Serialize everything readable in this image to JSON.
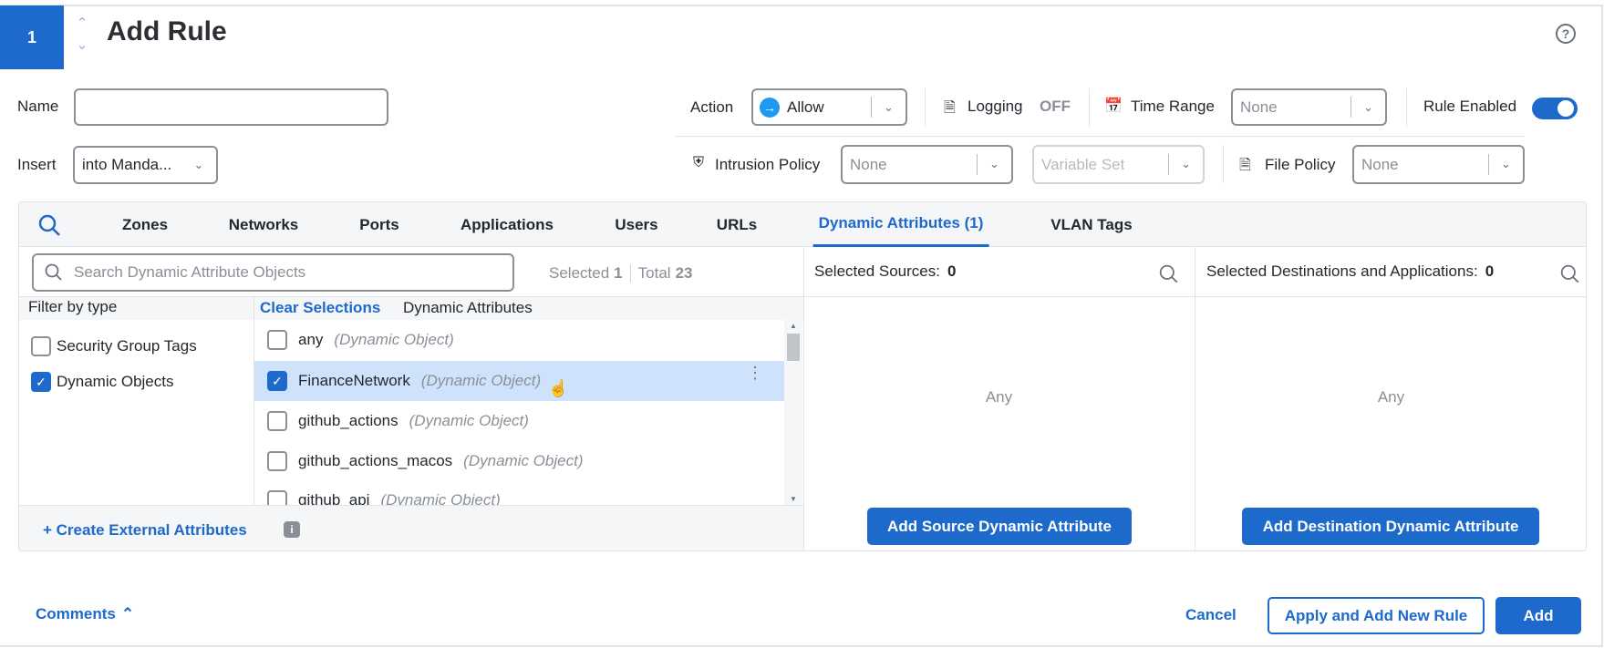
{
  "header": {
    "rule_number": "1",
    "title": "Add Rule",
    "help_icon": "question-circle-icon"
  },
  "form": {
    "name_label": "Name",
    "name_value": "",
    "insert_label": "Insert",
    "insert_value": "into Manda...",
    "action_label": "Action",
    "action_value": "Allow",
    "logging_label": "Logging",
    "logging_value": "OFF",
    "time_range_label": "Time Range",
    "time_range_placeholder": "None",
    "rule_enabled_label": "Rule Enabled",
    "rule_enabled": true,
    "intrusion_label": "Intrusion Policy",
    "intrusion_placeholder": "None",
    "variable_set_placeholder": "Variable Set",
    "file_policy_label": "File Policy",
    "file_policy_placeholder": "None"
  },
  "tabs": [
    {
      "label": "Zones"
    },
    {
      "label": "Networks"
    },
    {
      "label": "Ports"
    },
    {
      "label": "Applications"
    },
    {
      "label": "Users"
    },
    {
      "label": "URLs"
    },
    {
      "label": "Dynamic Attributes (1)",
      "active": true
    },
    {
      "label": "VLAN Tags"
    }
  ],
  "search": {
    "placeholder": "Search Dynamic Attribute Objects",
    "selected_label": "Selected",
    "selected_count": "1",
    "total_label": "Total",
    "total_count": "23"
  },
  "filter": {
    "title": "Filter by type",
    "items": [
      {
        "label": "Security Group Tags",
        "checked": false
      },
      {
        "label": "Dynamic Objects",
        "checked": true
      }
    ]
  },
  "list": {
    "clear_label": "Clear Selections",
    "header": "Dynamic Attributes",
    "items": [
      {
        "name": "any",
        "type": "(Dynamic Object)",
        "checked": false
      },
      {
        "name": "FinanceNetwork",
        "type": "(Dynamic Object)",
        "checked": true
      },
      {
        "name": "github_actions",
        "type": "(Dynamic Object)",
        "checked": false
      },
      {
        "name": "github_actions_macos",
        "type": "(Dynamic Object)",
        "checked": false
      },
      {
        "name": "github_api",
        "type": "(Dynamic Object)",
        "checked": false
      }
    ]
  },
  "create_external": "+ Create External Attributes",
  "sources": {
    "label": "Selected Sources:",
    "count": "0",
    "empty": "Any",
    "button": "Add Source Dynamic Attribute"
  },
  "destinations": {
    "label": "Selected Destinations and Applications:",
    "count": "0",
    "empty": "Any",
    "button": "Add Destination Dynamic Attribute"
  },
  "footer": {
    "comments": "Comments",
    "cancel": "Cancel",
    "apply_new": "Apply and Add New Rule",
    "add": "Add"
  },
  "colors": {
    "primary": "#1d69cc",
    "selected_row": "#cfe2fc"
  }
}
